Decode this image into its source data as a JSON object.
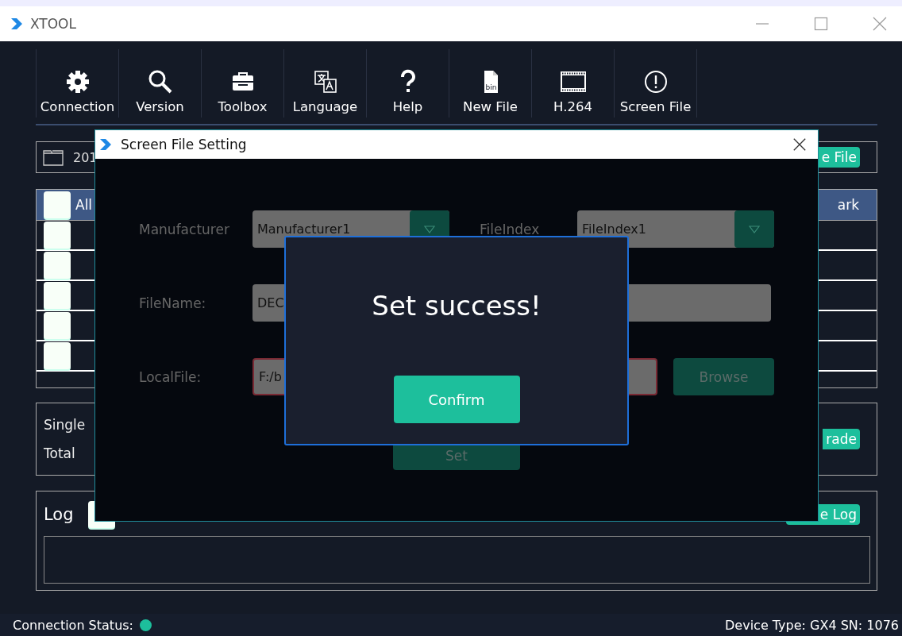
{
  "window": {
    "title": "XTOOL"
  },
  "toolbar": [
    {
      "kind": "gear",
      "label": "Connection"
    },
    {
      "kind": "search",
      "label": "Version"
    },
    {
      "kind": "toolbox",
      "label": "Toolbox"
    },
    {
      "kind": "language",
      "label": "Language"
    },
    {
      "kind": "help",
      "label": "Help"
    },
    {
      "kind": "file",
      "label": "New File",
      "badge": "bin"
    },
    {
      "kind": "film",
      "label": "H.264"
    },
    {
      "kind": "alert",
      "label": "Screen File"
    }
  ],
  "file_bar": {
    "path": "201",
    "button": "e File"
  },
  "table": {
    "header": {
      "checked": false,
      "column_1": "All",
      "column_last": "ark"
    },
    "rows": [
      {
        "checked": false
      },
      {
        "checked": false
      },
      {
        "checked": false
      },
      {
        "checked": false
      },
      {
        "checked": false
      }
    ]
  },
  "upgrade": {
    "labels": [
      "Single",
      "Total"
    ],
    "button": "rade"
  },
  "log": {
    "title": "Log",
    "checked": false,
    "button": "e Log"
  },
  "status_bar": {
    "connection_label": "Connection Status:",
    "connected": true,
    "device": "Device Type: GX4 SN: 1076"
  },
  "dialog": {
    "title": "Screen File Setting",
    "manufacturer_label": "Manufacturer",
    "manufacturer": "Manufacturer1",
    "file_index_label": "FileIndex",
    "file_index": "FileIndex1",
    "file_name_label": "FileName:",
    "file_name": "DEC",
    "local_file_label": "LocalFile:",
    "local_file": "F:/b",
    "local_file_invalid": true,
    "browse": "Browse",
    "set": "Set"
  },
  "popup": {
    "message": "Set success!",
    "button": "Confirm"
  }
}
